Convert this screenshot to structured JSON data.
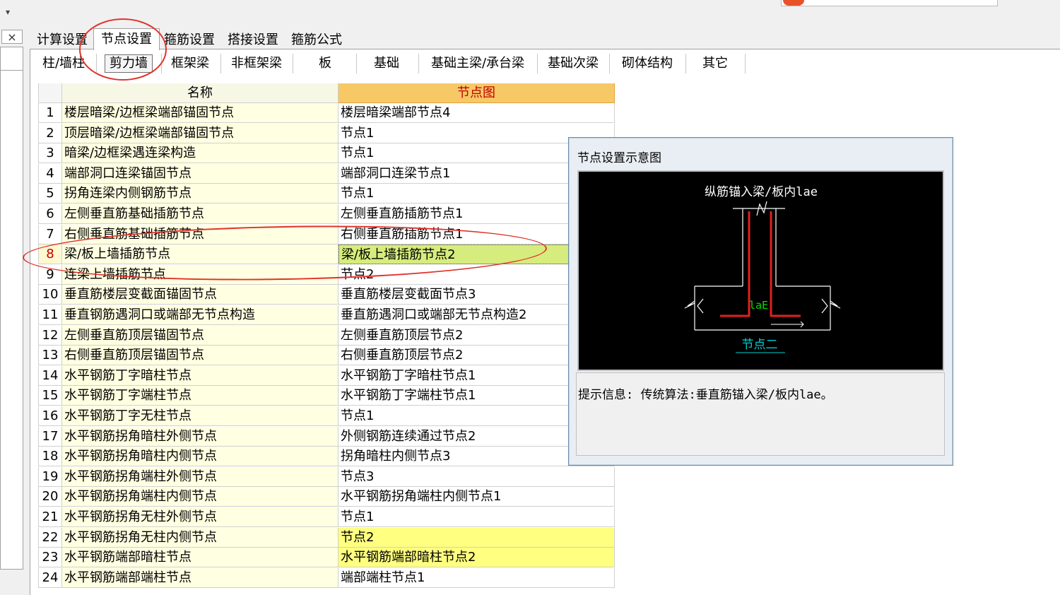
{
  "left": {
    "close_glyph": "×",
    "dropdown_glyph": "▾"
  },
  "tabs": [
    "计算设置",
    "节点设置",
    "箍筋设置",
    "搭接设置",
    "箍筋公式"
  ],
  "active_tab": 1,
  "subtabs": [
    "柱/墙柱",
    "剪力墙",
    "框架梁",
    "非框架梁",
    "板",
    "基础",
    "基础主梁/承台梁",
    "基础次梁",
    "砌体结构",
    "其它"
  ],
  "active_subtab": 1,
  "grid": {
    "headers": {
      "name": "名称",
      "node": "节点图"
    },
    "rows": [
      {
        "idx": "1",
        "name": "楼层暗梁/边框梁端部锚固节点",
        "node": "楼层暗梁端部节点4"
      },
      {
        "idx": "2",
        "name": "顶层暗梁/边框梁端部锚固节点",
        "node": "节点1"
      },
      {
        "idx": "3",
        "name": "暗梁/边框梁遇连梁构造",
        "node": "节点1"
      },
      {
        "idx": "4",
        "name": "端部洞口连梁锚固节点",
        "node": "端部洞口连梁节点1"
      },
      {
        "idx": "5",
        "name": "拐角连梁内侧钢筋节点",
        "node": "节点1"
      },
      {
        "idx": "6",
        "name": "左侧垂直筋基础插筋节点",
        "node": "左侧垂直筋插筋节点1"
      },
      {
        "idx": "7",
        "name": "右侧垂直筋基础插筋节点",
        "node": "右侧垂直筋插筋节点1"
      },
      {
        "idx": "8",
        "name": "梁/板上墙插筋节点",
        "node": "梁/板上墙插筋节点2"
      },
      {
        "idx": "9",
        "name": "连梁上墙插筋节点",
        "node": "节点2"
      },
      {
        "idx": "10",
        "name": "垂直筋楼层变截面锚固节点",
        "node": "垂直筋楼层变截面节点3"
      },
      {
        "idx": "11",
        "name": "垂直钢筋遇洞口或端部无节点构造",
        "node": "垂直筋遇洞口或端部无节点构造2"
      },
      {
        "idx": "12",
        "name": "左侧垂直筋顶层锚固节点",
        "node": "左侧垂直筋顶层节点2"
      },
      {
        "idx": "13",
        "name": "右侧垂直筋顶层锚固节点",
        "node": "右侧垂直筋顶层节点2"
      },
      {
        "idx": "14",
        "name": "水平钢筋丁字暗柱节点",
        "node": "水平钢筋丁字暗柱节点1"
      },
      {
        "idx": "15",
        "name": "水平钢筋丁字端柱节点",
        "node": "水平钢筋丁字端柱节点1"
      },
      {
        "idx": "16",
        "name": "水平钢筋丁字无柱节点",
        "node": "节点1"
      },
      {
        "idx": "17",
        "name": "水平钢筋拐角暗柱外侧节点",
        "node": "外侧钢筋连续通过节点2"
      },
      {
        "idx": "18",
        "name": "水平钢筋拐角暗柱内侧节点",
        "node": "拐角暗柱内侧节点3"
      },
      {
        "idx": "19",
        "name": "水平钢筋拐角端柱外侧节点",
        "node": "节点3"
      },
      {
        "idx": "20",
        "name": "水平钢筋拐角端柱内侧节点",
        "node": "水平钢筋拐角端柱内侧节点1"
      },
      {
        "idx": "21",
        "name": "水平钢筋拐角无柱外侧节点",
        "node": "节点1"
      },
      {
        "idx": "22",
        "name": "水平钢筋拐角无柱内侧节点",
        "node": "节点2"
      },
      {
        "idx": "23",
        "name": "水平钢筋端部暗柱节点",
        "node": "水平钢筋端部暗柱节点2"
      },
      {
        "idx": "24",
        "name": "水平钢筋端部端柱节点",
        "node": "端部端柱节点1"
      }
    ],
    "selected_row": 8,
    "highlighted_rows": [
      22,
      23
    ]
  },
  "popup": {
    "title": "节点设置示意图",
    "diagram": {
      "caption": "纵筋锚入梁/板内lae",
      "dim_label": "laE",
      "node_label": "节点二"
    },
    "info": "提示信息:  传统算法:垂直筋锚入梁/板内lae。"
  },
  "colors": {
    "rebar": "#e02020",
    "dim": "#00e000",
    "caption_link": "#00d0d0",
    "selected_node": "#d6ec7c",
    "highlight": "#ffff80",
    "header_node": "#f7c866"
  }
}
